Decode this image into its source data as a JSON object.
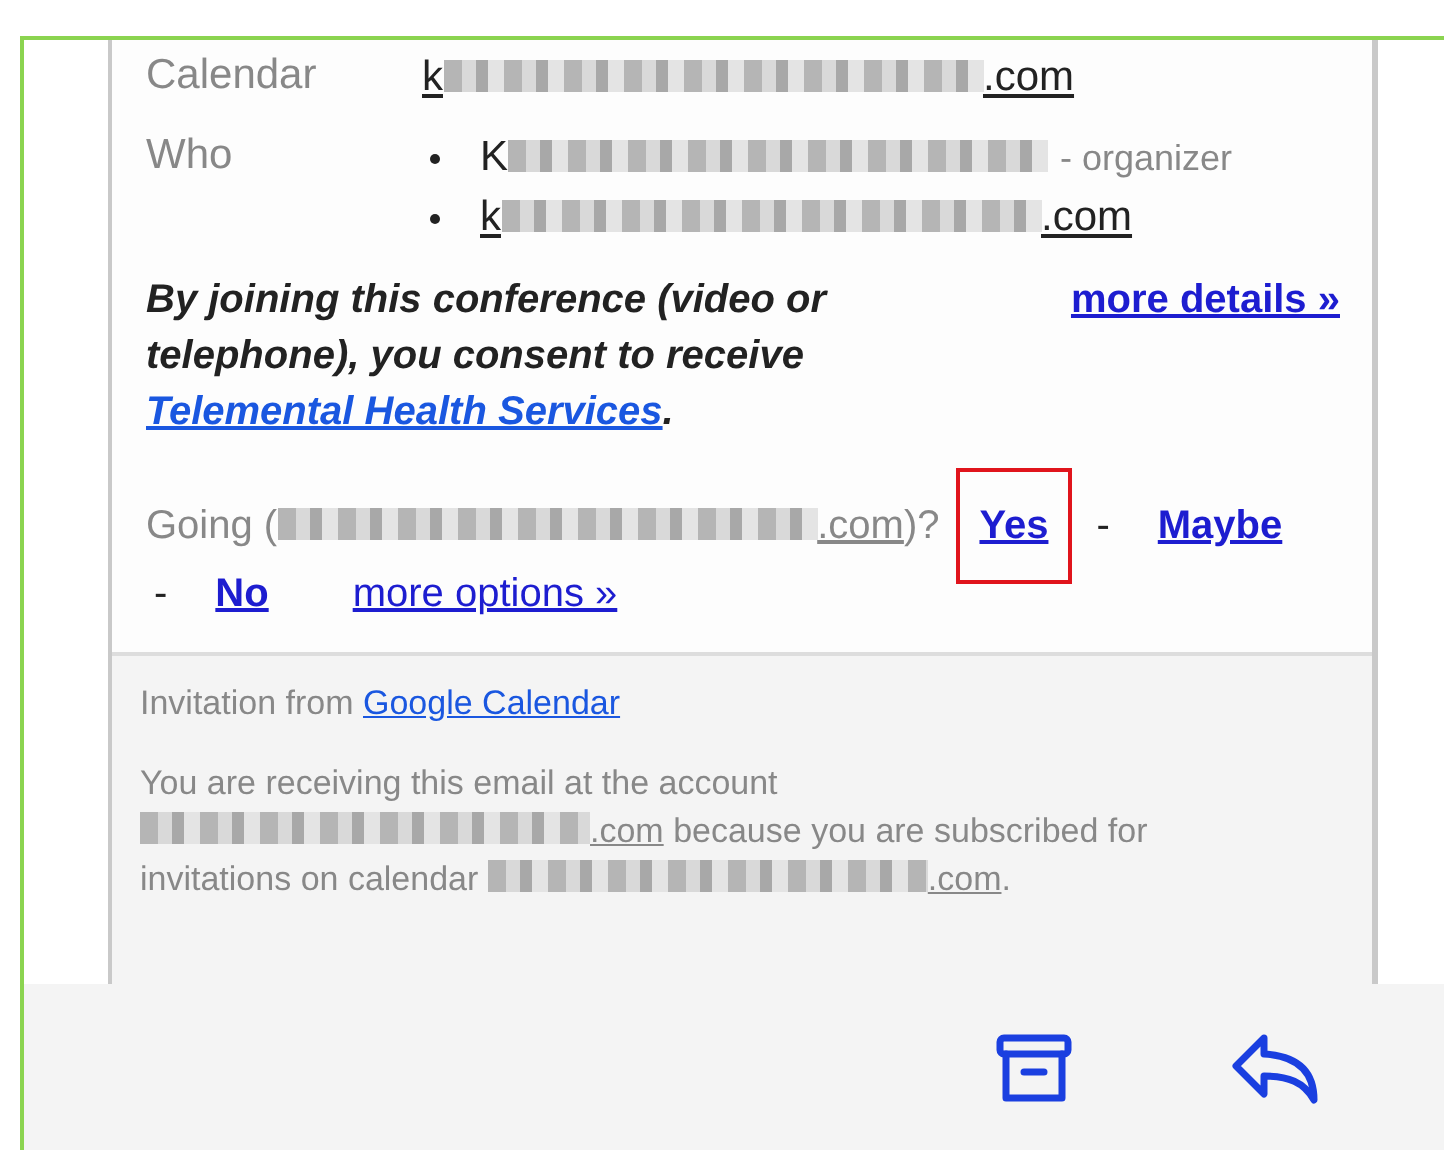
{
  "details": [
    {
      "label": "Calendar",
      "kind": "single",
      "items": [
        {
          "kind": "email",
          "prefix": "k",
          "suffix": ".com"
        }
      ]
    },
    {
      "label": "Who",
      "kind": "list",
      "items": [
        {
          "kind": "name",
          "prefix": "K",
          "note": "- organizer"
        },
        {
          "kind": "email",
          "prefix": "k",
          "suffix": ".com"
        }
      ]
    }
  ],
  "consent": {
    "before": "By joining this conference (video or telephone), you consent to receive ",
    "link": "Telemental Health Services",
    "after": ".",
    "more": "more details »"
  },
  "going": {
    "label": "Going (",
    "email_suffix": ".com",
    "end": ")?",
    "options": [
      {
        "label": "Yes",
        "highlighted": true
      },
      {
        "label": "Maybe",
        "highlighted": false
      },
      {
        "label": "No",
        "highlighted": false
      }
    ],
    "separator": "-",
    "more": "more options »"
  },
  "footer": {
    "invitation": "Invitation from ",
    "invitation_link": "Google Calendar",
    "line1": "You are receiving this email at the account",
    "account_suffix": ".com",
    "line2": " because you are subscribed for invitations on calendar ",
    "calendar_suffix": ".com",
    "end": "."
  },
  "toolbar": [
    {
      "kind": "archive"
    },
    {
      "kind": "reply"
    }
  ]
}
